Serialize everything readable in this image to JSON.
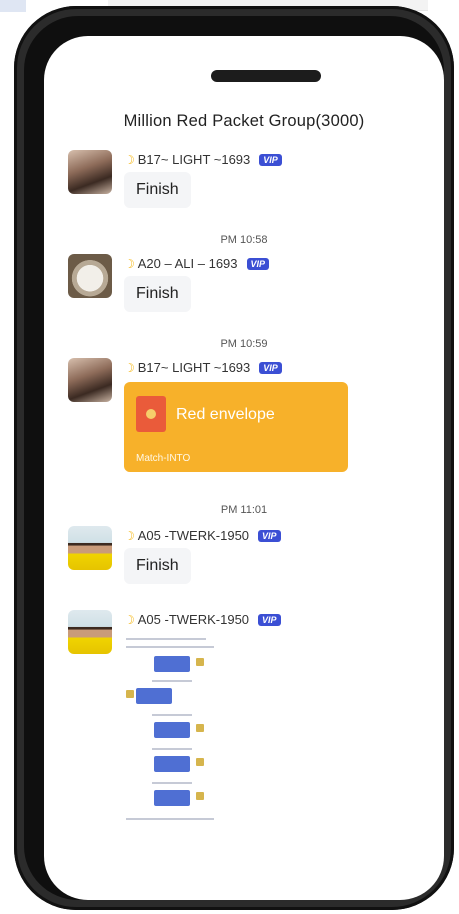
{
  "chat": {
    "title": "Million Red Packet Group(3000)"
  },
  "messages": [
    {
      "sender": "B17~ LIGHT ~1693",
      "vip": "VIP",
      "text": "Finish"
    },
    {
      "timestamp": "PM 10:58"
    },
    {
      "sender": "A20 – ALI – 1693",
      "vip": "VIP",
      "text": "Finish"
    },
    {
      "timestamp": "PM 10:59"
    },
    {
      "sender": "B17~ LIGHT ~1693",
      "vip": "VIP",
      "red_packet": {
        "title": "Red envelope",
        "footer": "Match-INTO"
      }
    },
    {
      "timestamp": "PM 11:01"
    },
    {
      "sender": "A05 -TWERK-1950",
      "vip": "VIP",
      "text": "Finish"
    },
    {
      "sender": "A05 -TWERK-1950",
      "vip": "VIP",
      "image": "screenshot-thumbnail"
    }
  ],
  "colors": {
    "red_packet_bg": "#f7b12a",
    "vip_badge": "#3b4fd4",
    "moon": "#f5b50e"
  }
}
